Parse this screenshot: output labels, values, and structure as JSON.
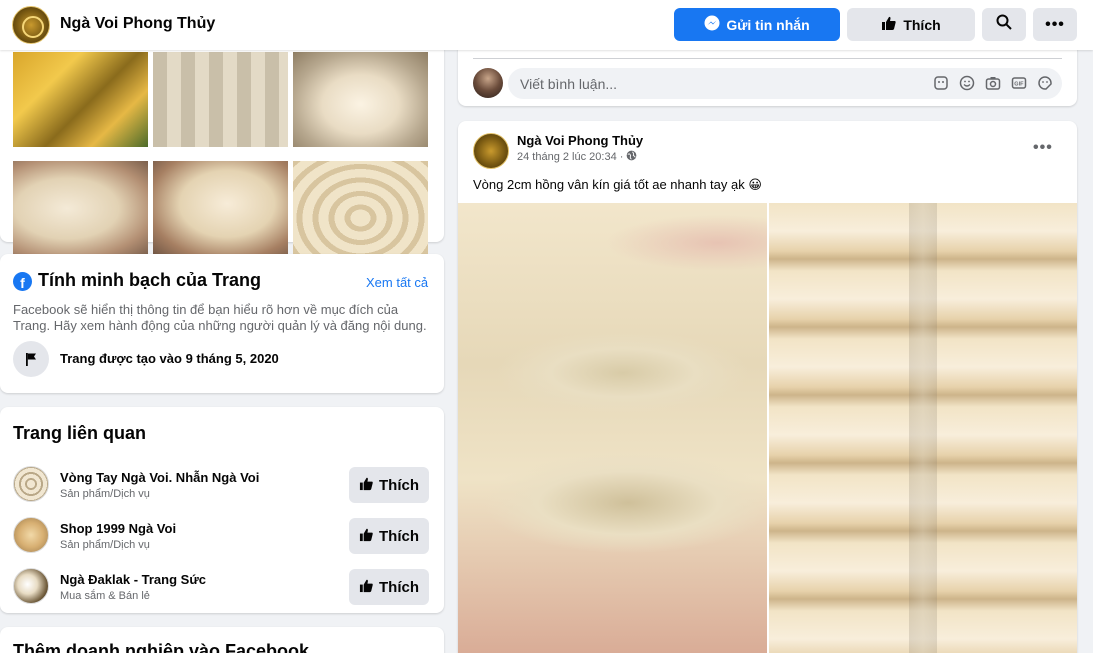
{
  "header": {
    "page_name": "Ngà Voi Phong Thủy",
    "message_button": "Gửi tin nhắn",
    "like_button": "Thích",
    "more": "•••"
  },
  "transparency": {
    "title": "Tính minh bạch của Trang",
    "see_all": "Xem tất cả",
    "description": "Facebook sẽ hiển thị thông tin để bạn hiểu rõ hơn về mục đích của Trang. Hãy xem hành động của những người quản lý và đăng nội dung.",
    "created": "Trang được tạo vào 9 tháng 5, 2020"
  },
  "related": {
    "title": "Trang liên quan",
    "items": [
      {
        "name": "Vòng Tay Ngà Voi. Nhẫn Ngà Voi",
        "category": "Sản phẩm/Dịch vụ",
        "like": "Thích"
      },
      {
        "name": "Shop 1999 Ngà Voi",
        "category": "Sản phẩm/Dịch vụ",
        "like": "Thích"
      },
      {
        "name": "Ngà Đaklak - Trang Sức",
        "category": "Mua sắm & Bán lẻ",
        "like": "Thích"
      }
    ]
  },
  "business": {
    "title": "Thêm doanh nghiệp vào Facebook"
  },
  "comment": {
    "placeholder": "Viết bình luận..."
  },
  "post": {
    "author": "Ngà Voi Phong Thủy",
    "time": "24 tháng 2 lúc 20:34 ·",
    "text": "Vòng 2cm hồng vân kín giá tốt ae nhanh tay  ạk 😀",
    "more": "•••"
  },
  "colors": {
    "accent": "#1877f2",
    "background": "#f0f2f5",
    "button_gray": "#e4e6eb"
  }
}
